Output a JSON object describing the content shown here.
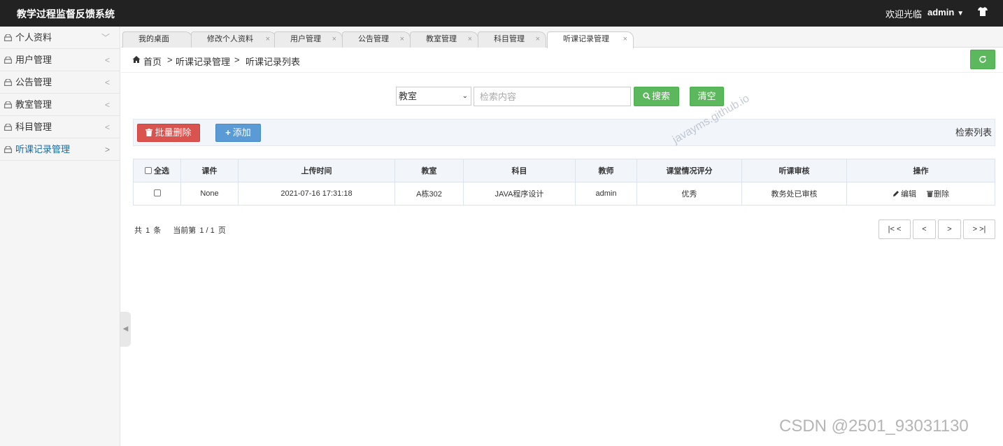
{
  "header": {
    "title": "教学过程监督反馈系统",
    "welcome": "欢迎光临",
    "username": "admin"
  },
  "sidebar": {
    "items": [
      {
        "label": "个人资料",
        "arrow": "﹀"
      },
      {
        "label": "用户管理",
        "arrow": "<"
      },
      {
        "label": "公告管理",
        "arrow": "<"
      },
      {
        "label": "教室管理",
        "arrow": "<"
      },
      {
        "label": "科目管理",
        "arrow": "<"
      },
      {
        "label": "听课记录管理",
        "arrow": ">"
      }
    ]
  },
  "tabs": [
    {
      "label": "我的桌面"
    },
    {
      "label": "修改个人资料"
    },
    {
      "label": "用户管理"
    },
    {
      "label": "公告管理"
    },
    {
      "label": "教室管理"
    },
    {
      "label": "科目管理"
    },
    {
      "label": "听课记录管理"
    }
  ],
  "breadcrumb": {
    "home": "首页",
    "level2": "听课记录管理",
    "level3": "听课记录列表",
    "sep": ">"
  },
  "search": {
    "field_selected": "教室",
    "placeholder": "检索内容",
    "search_label": "搜索",
    "clear_label": "清空"
  },
  "toolbar": {
    "batch_delete_label": "批量删除",
    "add_label": "添加",
    "list_title": "检索列表"
  },
  "table": {
    "headers": {
      "select_all": "全选",
      "courseware": "课件",
      "upload_time": "上传时间",
      "classroom": "教室",
      "subject": "科目",
      "teacher": "教师",
      "rating": "课堂情况评分",
      "review": "听课审核",
      "actions": "操作"
    },
    "rows": [
      {
        "courseware": "None",
        "upload_time": "2021-07-16 17:31:18",
        "classroom": "A栋302",
        "subject": "JAVA程序设计",
        "teacher": "admin",
        "rating": "优秀",
        "review": "教务处已审核",
        "edit_label": "编辑",
        "delete_label": "删除"
      }
    ]
  },
  "pagination": {
    "total_prefix": "共",
    "total": "1",
    "total_suffix": "条",
    "current_prefix": "当前第",
    "current": "1 / 1",
    "current_suffix": "页",
    "first": "|< <",
    "prev": "<",
    "next": ">",
    "last": "> >|"
  },
  "watermarks": {
    "site": "javayms.github.io",
    "csdn": "CSDN @2501_93031130"
  },
  "colors": {
    "header_bg": "#222222",
    "success": "#5cb85c",
    "danger": "#d9534f",
    "primary": "#5b9bd5",
    "active_nav": "#1b6aa5"
  }
}
